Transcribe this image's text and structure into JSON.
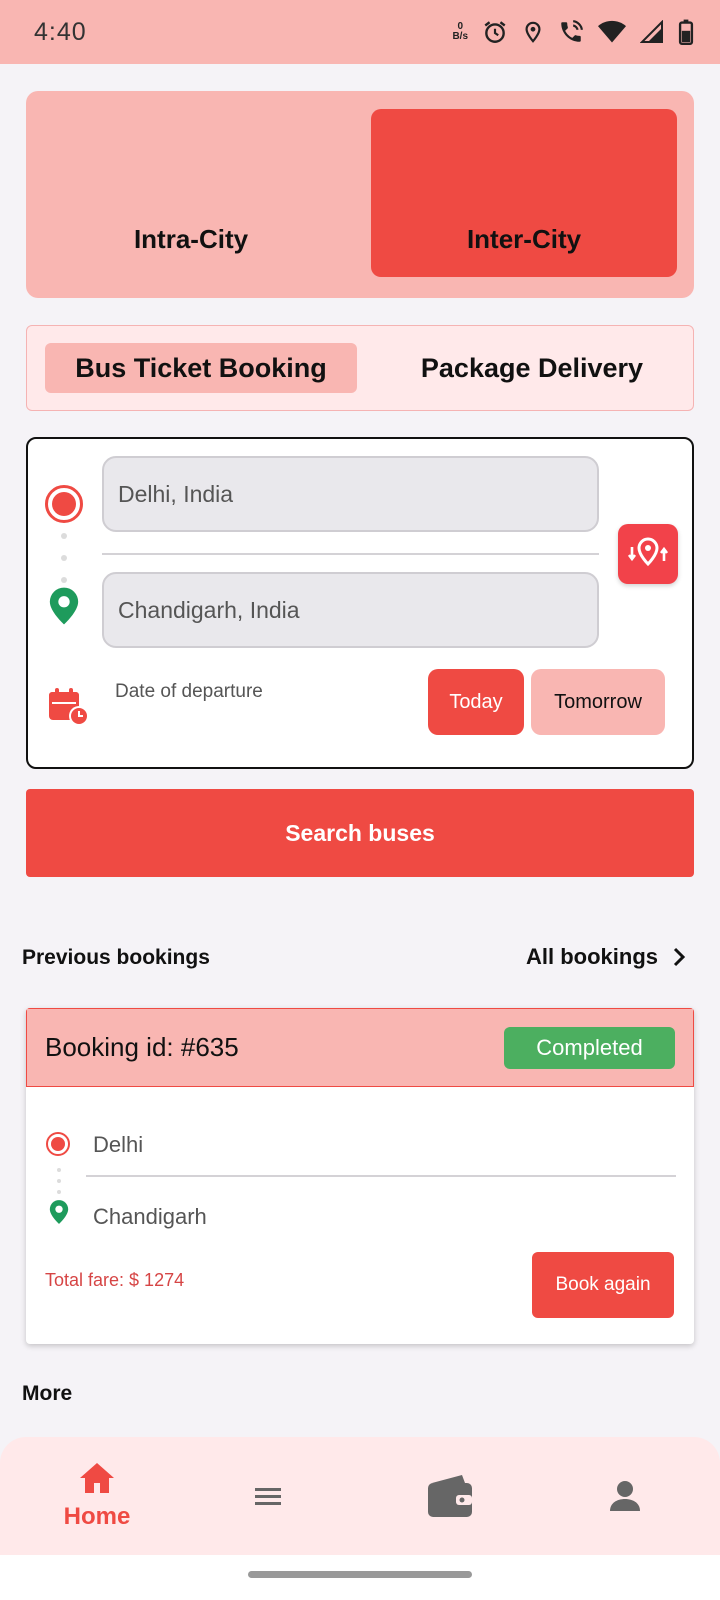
{
  "status_bar": {
    "time": "4:40",
    "net_speed_value": "0",
    "net_speed_unit": "B/s",
    "icons": [
      "alarm-icon",
      "location-icon",
      "wifi-call-icon",
      "wifi-icon",
      "signal-icon",
      "battery-icon"
    ]
  },
  "mode": {
    "intra_label": "Intra-City",
    "inter_label": "Inter-City",
    "selected": "Inter-City"
  },
  "service": {
    "bus_label": "Bus Ticket Booking",
    "package_label": "Package Delivery",
    "selected": "Bus Ticket Booking"
  },
  "search": {
    "from_value": "Delhi, India",
    "to_value": "Chandigarh, India",
    "date_label": "Date of departure",
    "today_label": "Today",
    "tomorrow_label": "Tomorrow",
    "selected_date": "Today",
    "search_button_label": "Search buses"
  },
  "previous": {
    "title": "Previous bookings",
    "all_label": "All bookings",
    "booking": {
      "id_text": "Booking id: #635",
      "status": "Completed",
      "from": "Delhi",
      "to": "Chandigarh",
      "fare_text": "Total fare: $ 1274",
      "book_again_label": "Book again"
    }
  },
  "more": {
    "title": "More"
  },
  "nav": {
    "home_label": "Home",
    "items": [
      "home-icon",
      "menu-icon",
      "wallet-icon",
      "profile-icon"
    ],
    "active": "Home"
  },
  "colors": {
    "accent": "#ef4a43",
    "accent_light": "#f9b6b2",
    "panel_pink": "#ffe9ea",
    "success": "#4caf60",
    "pin_green": "#1e9b5c"
  }
}
